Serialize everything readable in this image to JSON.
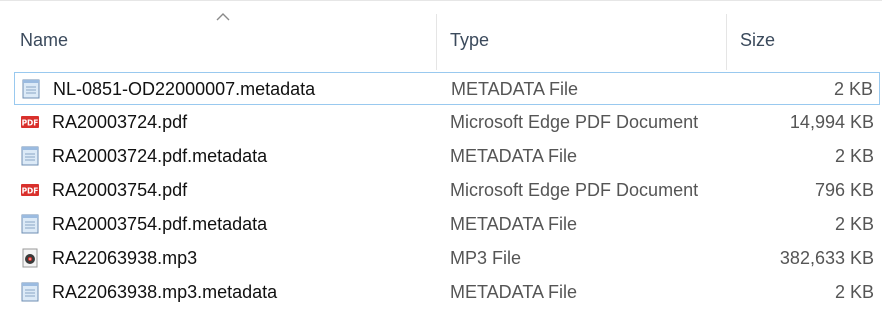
{
  "header": {
    "name_label": "Name",
    "type_label": "Type",
    "size_label": "Size",
    "sort_indicator": "chevron-up-icon"
  },
  "files": [
    {
      "name": "NL-0851-OD22000007.metadata",
      "type": "METADATA File",
      "size": "2 KB",
      "icon": "metadata-file-icon",
      "focused": true
    },
    {
      "name": "RA20003724.pdf",
      "type": "Microsoft Edge PDF Document",
      "size": "14,994 KB",
      "icon": "pdf-file-icon"
    },
    {
      "name": "RA20003724.pdf.metadata",
      "type": "METADATA File",
      "size": "2 KB",
      "icon": "metadata-file-icon"
    },
    {
      "name": "RA20003754.pdf",
      "type": "Microsoft Edge PDF Document",
      "size": "796 KB",
      "icon": "pdf-file-icon"
    },
    {
      "name": "RA20003754.pdf.metadata",
      "type": "METADATA File",
      "size": "2 KB",
      "icon": "metadata-file-icon"
    },
    {
      "name": "RA22063938.mp3",
      "type": "MP3 File",
      "size": "382,633 KB",
      "icon": "mp3-file-icon"
    },
    {
      "name": "RA22063938.mp3.metadata",
      "type": "METADATA File",
      "size": "2 KB",
      "icon": "metadata-file-icon"
    }
  ],
  "colors": {
    "focus_border": "#99c9ef",
    "pdf_red": "#d9302c",
    "header_text": "#3b4a5c"
  }
}
